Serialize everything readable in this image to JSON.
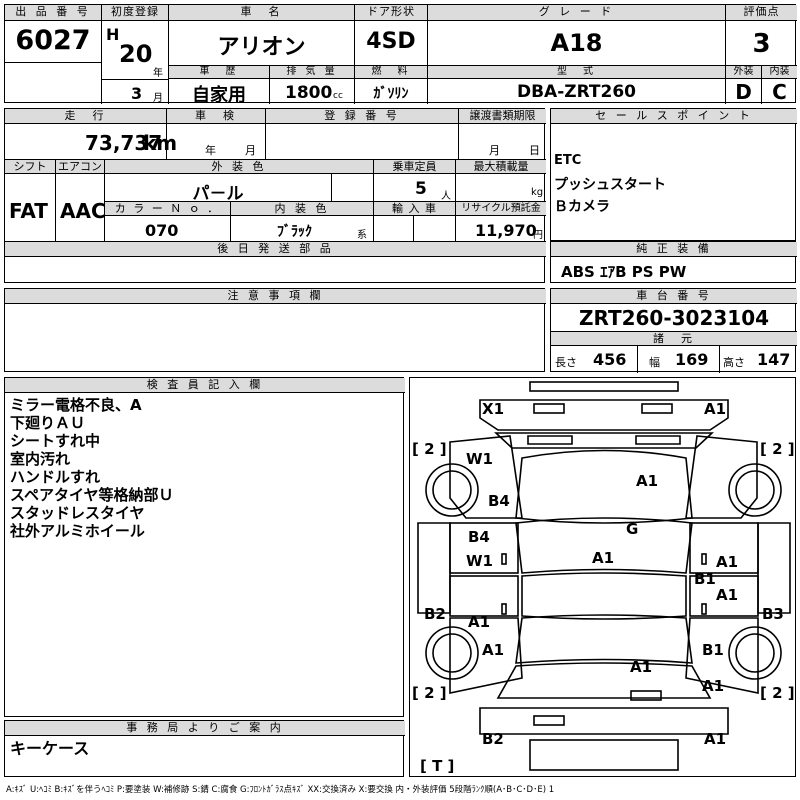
{
  "header": {
    "lot_label": "出 品 番 号",
    "lot_value": "6027",
    "first_reg_label": "初度登録",
    "era_letter": "H",
    "year_value": "20",
    "year_unit": "年",
    "month_value": "3",
    "month_unit": "月",
    "name_label": "車　名",
    "name_value": "アリオン",
    "door_label": "ドア形状",
    "door_value": "4SD",
    "grade_label": "グ レ ー ド",
    "grade_value": "A18",
    "score_label": "評価点",
    "score_value": "3",
    "history_label": "車　歴",
    "history_value": "自家用",
    "displacement_label": "排 気 量",
    "displacement_value": "1800",
    "displacement_unit": "cc",
    "fuel_label": "燃　料",
    "fuel_value": "ｶﾞｿﾘﾝ",
    "model_label": "型　式",
    "model_value": "DBA-ZRT260",
    "exterior_label": "外装",
    "exterior_value": "D",
    "interior_label": "内装",
    "interior_value": "C"
  },
  "row2": {
    "mileage_label": "走　行",
    "mileage_value": "73,737",
    "mileage_unit": "km",
    "inspection_label": "車　検",
    "inspection_year": "年",
    "inspection_month": "月",
    "regnum_label": "登 録 番 号",
    "transfer_label": "譲渡書類期限",
    "transfer_month": "月",
    "transfer_day": "日",
    "shift_label": "シフト",
    "shift_value": "FAT",
    "ac_label": "エアコン",
    "ac_value": "AAC",
    "color_label": "外 装 色",
    "color_value": "パ－ル",
    "capacity_label": "乗車定員",
    "capacity_value": "5",
    "capacity_unit": "人",
    "maxload_label": "最大積載量",
    "maxload_unit": "kg",
    "colorno_label": "カ ラ ー Ｎ ｏ ．",
    "colorno_value": "070",
    "intcolor_label": "内 装 色",
    "intcolor_value": "ﾌﾞﾗｯｸ",
    "intcolor_unit": "系",
    "import_label": "輸 入 車",
    "recycle_label": "リサイクル預託金",
    "recycle_value": "11,970",
    "recycle_unit": "円",
    "later_label": "後 日 発 送 部 品"
  },
  "sales": {
    "label": "セ ー ル ス ポ イ ン ト",
    "items": [
      "ETC",
      "プッシュスタート",
      "Ｂカメラ"
    ]
  },
  "equipment": {
    "label": "純 正 装 備",
    "value": "ABS ｴｱB PS PW"
  },
  "caution": {
    "label": "注 意 事 項 欄"
  },
  "chassis": {
    "label": "車 台 番 号",
    "value": "ZRT260-3023104",
    "spec_label": "諸　元",
    "length_label": "長さ",
    "length_value": "456",
    "width_label": "幅",
    "width_value": "169",
    "height_label": "高さ",
    "height_value": "147"
  },
  "inspector": {
    "label": "検 査 員 記 入 欄",
    "notes": [
      "ミラー電格不良、A",
      "下廻りＡＵ",
      "シートすれ中",
      "室内汚れ",
      "ハンドルすれ",
      "スペアタイヤ等格納部Ｕ",
      "スタッドレスタイヤ",
      "社外アルミホイール"
    ]
  },
  "office": {
    "label": "事 務 局 よ り ご 案 内",
    "value": "キーケース"
  },
  "diagram": {
    "marks": [
      "X1",
      "A1",
      "W1",
      "B4",
      "A1",
      "G",
      "B4",
      "W1",
      "A1",
      "A1",
      "B1",
      "A1",
      "B2",
      "A1",
      "B3",
      "A1",
      "A1",
      "B1",
      "A1",
      "B2",
      "A1"
    ],
    "tire_labels": [
      "[ 2 ]",
      "[ 2 ]",
      "[ 2 ]",
      "[ 2 ]"
    ],
    "tray_label": "[ T ]"
  },
  "legend": "A:ｷｽﾞ U:ﾍｺﾐ B:ｷｽﾞを伴うﾍｺﾐ P:要塗装 W:補修跡 S:錆 C:腐食 G:ﾌﾛﾝﾄｶﾞﾗｽ点ｷｽﾞ XX:交換済み X:要交換 内・外装評価 5段階ﾗﾝｸ順(A･B･C･D･E) 1"
}
